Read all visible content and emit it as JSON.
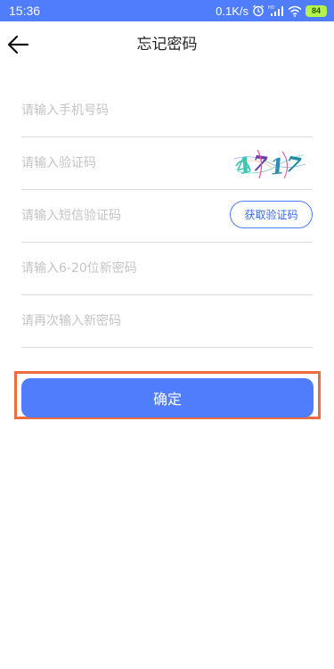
{
  "status_bar": {
    "time": "15:36",
    "network_speed": "0.1K/s",
    "battery": "84",
    "icons": [
      "alarm-icon",
      "signal-icon",
      "wifi-icon",
      "battery-icon"
    ],
    "background_color": "#4f7dfb"
  },
  "header": {
    "title": "忘记密码",
    "back_icon": "back-arrow-icon"
  },
  "form": {
    "phone": {
      "placeholder": "请输入手机号码",
      "value": ""
    },
    "captcha": {
      "placeholder": "请输入验证码",
      "value": "",
      "image_text": "4717"
    },
    "sms_code": {
      "placeholder": "请输入短信验证码",
      "value": "",
      "button_label": "获取验证码"
    },
    "new_password": {
      "placeholder": "请输入6-20位新密码",
      "value": ""
    },
    "confirm_password": {
      "placeholder": "请再次输入新密码",
      "value": ""
    }
  },
  "confirm_button": {
    "label": "确定",
    "color": "#4f7dfb",
    "highlight_color": "#ee6d3f"
  }
}
